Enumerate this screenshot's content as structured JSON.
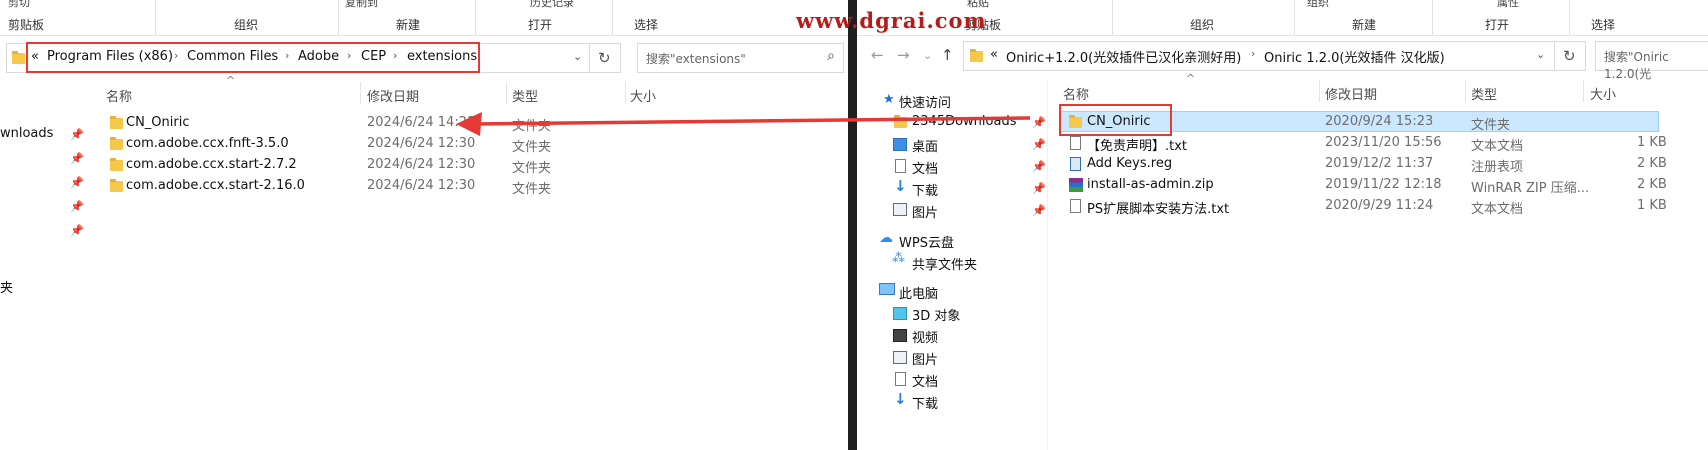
{
  "watermark": "www.dgrai.com",
  "left": {
    "ribbon": {
      "top_labels": [
        "剪切",
        "复制到",
        "历史记录"
      ],
      "groups": [
        "剪贴板",
        "组织",
        "新建",
        "打开",
        "选择"
      ]
    },
    "breadcrumb": {
      "overflow": "«",
      "items": [
        "Program Files (x86)",
        "Common Files",
        "Adobe",
        "CEP",
        "extensions"
      ]
    },
    "search_placeholder": "搜索\"extensions\"",
    "columns": [
      "名称",
      "修改日期",
      "类型",
      "大小"
    ],
    "nav": [
      {
        "label": "wnloads"
      },
      {
        "label": "夹"
      }
    ],
    "files": [
      {
        "name": "CN_Oniric",
        "date": "2024/6/24 14:28",
        "type": "文件夹",
        "size": ""
      },
      {
        "name": "com.adobe.ccx.fnft-3.5.0",
        "date": "2024/6/24 12:30",
        "type": "文件夹",
        "size": ""
      },
      {
        "name": "com.adobe.ccx.start-2.7.2",
        "date": "2024/6/24 12:30",
        "type": "文件夹",
        "size": ""
      },
      {
        "name": "com.adobe.ccx.start-2.16.0",
        "date": "2024/6/24 12:30",
        "type": "文件夹",
        "size": ""
      }
    ]
  },
  "right": {
    "ribbon": {
      "top_labels": [
        "粘贴",
        "组织",
        "属性"
      ],
      "groups": [
        "剪贴板",
        "组织",
        "新建",
        "打开",
        "选择"
      ]
    },
    "breadcrumb": {
      "overflow": "«",
      "items": [
        "Oniric+1.2.0(光效插件已汉化亲测好用)",
        "Oniric 1.2.0(光效插件 汉化版)"
      ]
    },
    "search_placeholder": "搜索\"Oniric 1.2.0(光",
    "columns": [
      "名称",
      "修改日期",
      "类型",
      "大小"
    ],
    "nav": {
      "quick_access": "快速访问",
      "quick_items": [
        "2345Downloads",
        "桌面",
        "文档",
        "下载",
        "图片"
      ],
      "wps": "WPS云盘",
      "shared": "共享文件夹",
      "this_pc": "此电脑",
      "pc_items": [
        "3D 对象",
        "视频",
        "图片",
        "文档",
        "下载"
      ]
    },
    "files": [
      {
        "name": "CN_Oniric",
        "date": "2020/9/24 15:23",
        "type": "文件夹",
        "size": "",
        "icon": "folder-icon"
      },
      {
        "name": "【免责声明】.txt",
        "date": "2023/11/20 15:56",
        "type": "文本文档",
        "size": "1 KB",
        "icon": "text-file-icon"
      },
      {
        "name": "Add Keys.reg",
        "date": "2019/12/2 11:37",
        "type": "注册表项",
        "size": "2 KB",
        "icon": "registry-file-icon"
      },
      {
        "name": "install-as-admin.zip",
        "date": "2019/11/22 12:18",
        "type": "WinRAR ZIP 压缩...",
        "size": "2 KB",
        "icon": "zip-archive-icon"
      },
      {
        "name": "PS扩展脚本安装方法.txt",
        "date": "2020/9/29 11:24",
        "type": "文本文档",
        "size": "1 KB",
        "icon": "text-file-icon"
      }
    ]
  },
  "colors": {
    "highlight": "#e53935",
    "selection": "#cce8ff",
    "folder": "#f5c84a"
  }
}
